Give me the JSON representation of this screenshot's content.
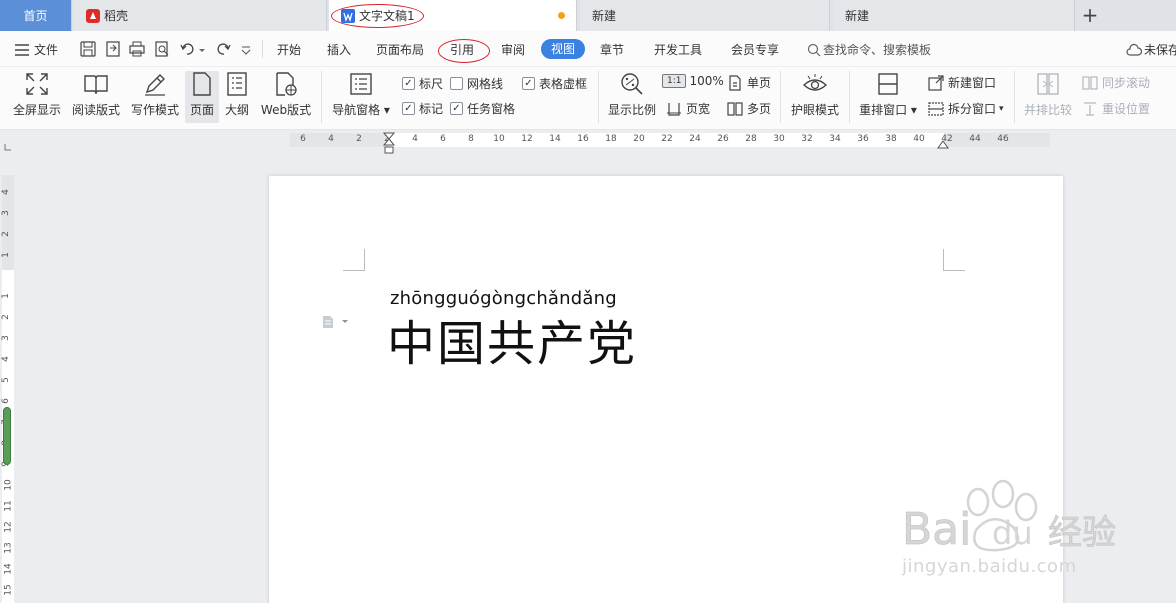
{
  "tabs": {
    "home": "首页",
    "daoke": "稻壳",
    "doc": "文字文稿1",
    "new1": "新建",
    "new2": "新建",
    "add": "+"
  },
  "menu": {
    "file": "文件",
    "items": [
      "开始",
      "插入",
      "页面布局",
      "引用",
      "审阅",
      "视图",
      "章节",
      "开发工具",
      "会员专享"
    ],
    "search_placeholder": "查找命令、搜索模板",
    "unsaved": "未保存"
  },
  "ribbon": {
    "fullscreen": "全屏显示",
    "reading": "阅读版式",
    "writing": "写作模式",
    "page": "页面",
    "outline": "大纲",
    "web": "Web版式",
    "nav_pane": "导航窗格",
    "ruler": "标尺",
    "gridlines": "网格线",
    "table_gridlines": "表格虚框",
    "markup": "标记",
    "task_pane": "任务窗格",
    "zoom_label": "显示比例",
    "zoom_value": "100%",
    "page_width": "页宽",
    "single_page": "单页",
    "multi_page": "多页",
    "eye_mode": "护眼模式",
    "rearrange": "重排窗口",
    "new_window": "新建窗口",
    "split_window": "拆分窗口",
    "side_by_side": "并排比较",
    "sync_scroll": "同步滚动",
    "reset_position": "重设位置"
  },
  "checkboxes": {
    "ruler": true,
    "gridlines": false,
    "table_gridlines": true,
    "markup": true,
    "task_pane": true
  },
  "hruler_labels": [
    "6",
    "4",
    "2",
    "2",
    "4",
    "6",
    "8",
    "10",
    "12",
    "14",
    "16",
    "18",
    "20",
    "22",
    "24",
    "26",
    "28",
    "30",
    "32",
    "34",
    "36",
    "38",
    "40",
    "42",
    "44",
    "46"
  ],
  "vruler_labels": [
    "4",
    "3",
    "2",
    "1",
    "1",
    "2",
    "3",
    "4",
    "5",
    "6",
    "7",
    "8",
    "9",
    "10",
    "11",
    "12",
    "13",
    "14",
    "15"
  ],
  "document": {
    "pinyin": "zhōngguógòngchǎndǎng",
    "hanzi": "中国共产党"
  },
  "watermark": {
    "brand": "Bai",
    "brand2": "du",
    "product": "经验",
    "url": "jingyan.baidu.com"
  },
  "colors": {
    "accent": "#3b82e0",
    "home_tab": "#5b8fd8",
    "annotation": "#d9232e"
  }
}
